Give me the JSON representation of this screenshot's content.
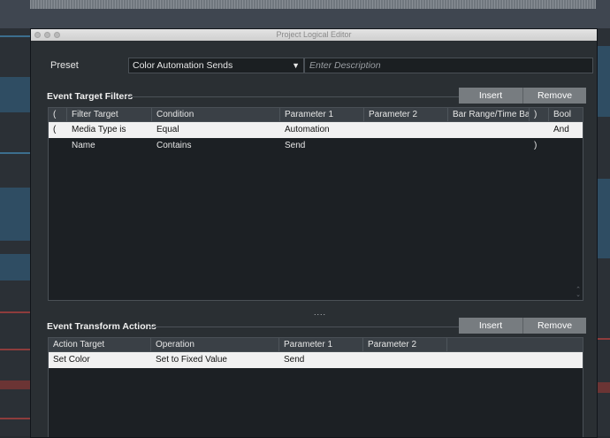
{
  "window": {
    "title": "Project Logical Editor"
  },
  "preset": {
    "label": "Preset",
    "selected": "Color Automation Sends",
    "description_placeholder": "Enter Description"
  },
  "filters": {
    "title": "Event Target Filters",
    "insert_label": "Insert",
    "remove_label": "Remove",
    "columns": [
      "(",
      "Filter Target",
      "Condition",
      "Parameter 1",
      "Parameter 2",
      "Bar Range/Time Base",
      ")",
      "Bool"
    ],
    "rows": [
      {
        "open": "(",
        "target": "Media Type is",
        "condition": "Equal",
        "param1": "Automation",
        "param2": "",
        "range": "",
        "close": "",
        "bool": "And"
      },
      {
        "open": "",
        "target": "Name",
        "condition": "Contains",
        "param1": "Send",
        "param2": "",
        "range": "",
        "close": ")",
        "bool": ""
      }
    ]
  },
  "actions": {
    "title": "Event Transform Actions",
    "insert_label": "Insert",
    "remove_label": "Remove",
    "columns": [
      "Action Target",
      "Operation",
      "Parameter 1",
      "Parameter 2"
    ],
    "rows": [
      {
        "target": "Set Color",
        "operation": "Set to Fixed Value",
        "param1": "Send",
        "param2": ""
      }
    ]
  },
  "splitter_glyph": "....",
  "colors": {
    "accent_button": "#777c80",
    "selected_row": "#f1f1f1",
    "panel_bg": "#2a2f33"
  }
}
